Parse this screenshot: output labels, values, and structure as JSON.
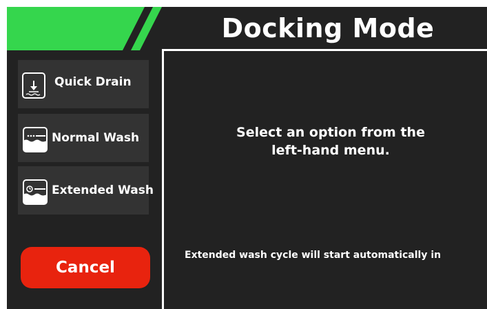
{
  "header": {
    "title": "Docking Mode"
  },
  "colors": {
    "accent_green": "#35d64d",
    "cancel_red": "#e8230e",
    "panel_dark": "#222222",
    "button_dark": "#333333"
  },
  "sidebar": {
    "items": [
      {
        "label": "Quick Drain",
        "icon": "drain-icon"
      },
      {
        "label": "Normal Wash",
        "icon": "wash-icon"
      },
      {
        "label": "Extended Wash",
        "icon": "extended-wash-icon"
      }
    ],
    "cancel_label": "Cancel"
  },
  "main": {
    "prompt_line1": "Select an option from the",
    "prompt_line2": "left-hand menu.",
    "countdown_text": "Extended wash cycle will  start automatically in"
  }
}
